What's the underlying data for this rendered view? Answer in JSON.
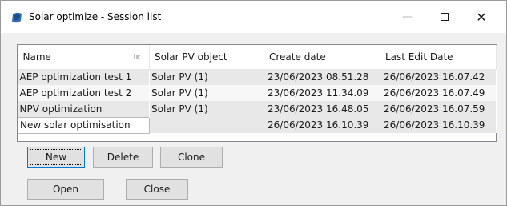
{
  "window": {
    "title": "Solar optimize - Session list",
    "icon": "solar-app-icon",
    "controls": {
      "minimize": "—",
      "close": "✕"
    }
  },
  "table": {
    "columns": [
      "Name",
      "Solar PV object",
      "Create date",
      "Last Edit Date"
    ],
    "sort_column": "Name",
    "rows": [
      {
        "name": "AEP optimization test 1",
        "object": "Solar PV (1)",
        "created": "23/06/2023 08.51.28",
        "edited": "26/06/2023 16.07.42"
      },
      {
        "name": "AEP optimization test 2",
        "object": "Solar PV (1)",
        "created": "23/06/2023 11.34.09",
        "edited": "26/06/2023 16.07.49"
      },
      {
        "name": "NPV optimization",
        "object": "Solar PV (1)",
        "created": "23/06/2023 16.48.05",
        "edited": "26/06/2023 16.07.59"
      },
      {
        "name": "New solar optimisation",
        "object": "",
        "created": "26/06/2023 16.10.39",
        "edited": "26/06/2023 16.10.39"
      }
    ]
  },
  "buttons": {
    "new": "New",
    "delete": "Delete",
    "clone": "Clone",
    "open": "Open",
    "close": "Close"
  },
  "colors": {
    "accent": "#0078d7",
    "icon": "#2b6cb0"
  }
}
